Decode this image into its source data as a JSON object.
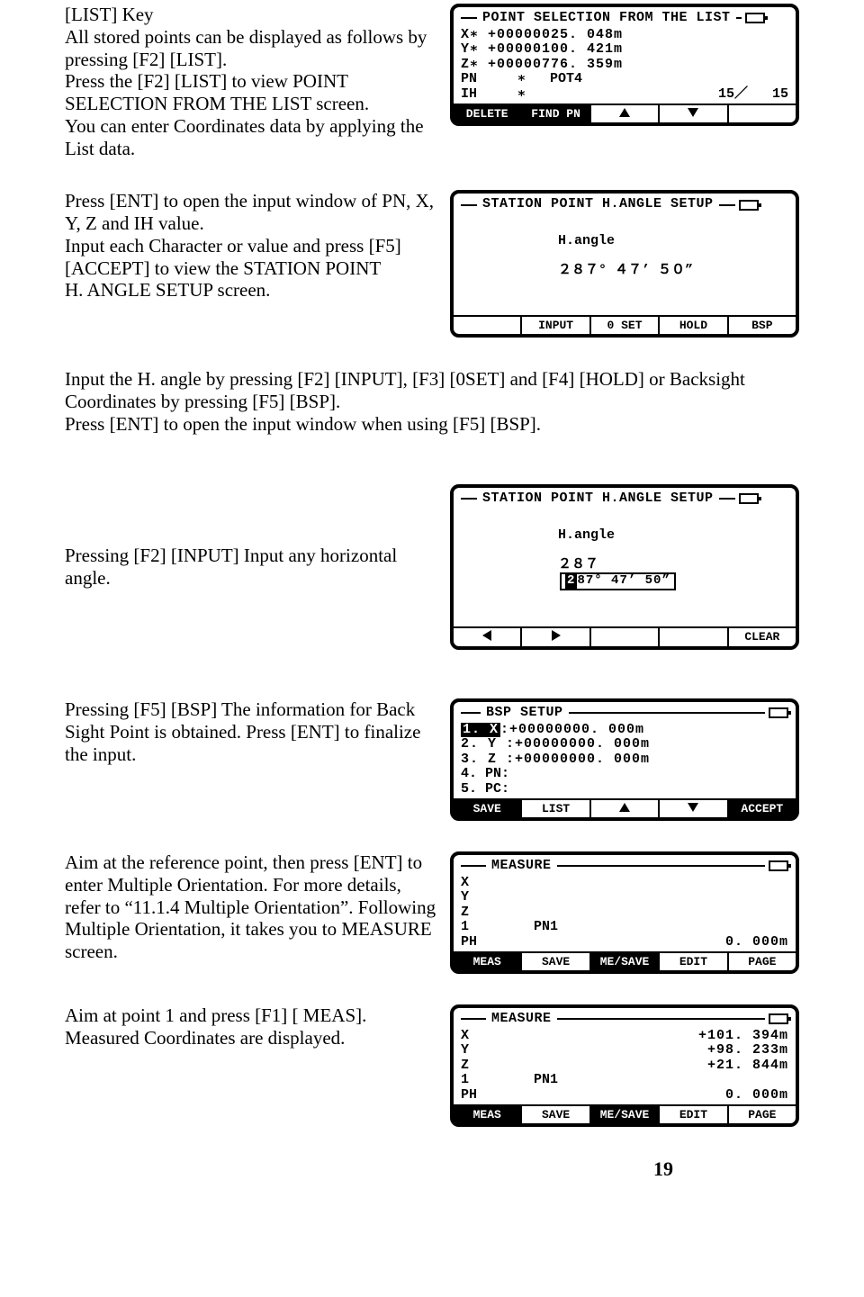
{
  "p1": {
    "l1": "[LIST] Key",
    "l2": "All stored points can be displayed as follows by pressing [F2] [LIST].",
    "l3": "Press the [F2] [LIST] to view POINT SELECTION FROM THE LIST screen.",
    "l4": "You can enter Coordinates data by applying the List data."
  },
  "p2": {
    "l1": "Press [ENT] to open the input window of PN, X, Y, Z and IH value.",
    "l2": "Input each Character or value and press [F5] [ACCEPT] to view the STATION POINT",
    "l3": "H. ANGLE SETUP screen."
  },
  "p3": {
    "l1": "Input the H. angle by pressing [F2] [INPUT], [F3] [0SET] and [F4] [HOLD] or Backsight Coordinates by pressing [F5] [BSP].",
    "l2": "Press [ENT] to open the input window when using [F5] [BSP]."
  },
  "p4": "Pressing [F2] [INPUT] Input any horizontal angle.",
  "p5": "Pressing [F5] [BSP] The information for Back Sight Point is obtained. Press [ENT] to finalize the input.",
  "p6": "Aim at the reference point, then press [ENT] to enter  Multiple Orientation. For more details, refer to “11.1.4  Multiple Orientation”. Following Multiple Orientation, it takes you to MEASURE screen.",
  "p7": "Aim at point 1 and press [F1] [ MEAS]. Measured Coordinates are displayed.",
  "page_number": "19",
  "s1": {
    "title": "POINT SELECTION FROM THE LIST",
    "x": "X∗ +00000025. 048m",
    "y": "Y∗ +00000100. 421m",
    "z": "Z∗ +00000776. 359m",
    "pn": "PN     ∗   POT4",
    "ih_l": "IH     ∗",
    "ih_r": "15／   15",
    "sk1": "DELETE",
    "sk2": "FIND PN"
  },
  "s2": {
    "title": "STATION POINT H.ANGLE SETUP",
    "lab": "H.angle",
    "val": "２８７° ４７’ ５０”",
    "sk2": "INPUT",
    "sk3": "0 SET",
    "sk4": "HOLD",
    "sk5": "BSP"
  },
  "s3": {
    "title": "STATION POINT H.ANGLE SETUP",
    "lab": "H.angle",
    "pre": "２８７",
    "cur": "2",
    "rest": "87° 47’ 50”",
    "sk5": "CLEAR"
  },
  "s4": {
    "title": "BSP SETUP",
    "r1a": "1. X",
    "r1b": ":+00000000. 000m",
    "r2": "2. Y :+00000000. 000m",
    "r3": "3. Z :+00000000. 000m",
    "r4": "4. PN:",
    "r5": "5. PC:",
    "sk1": "SAVE",
    "sk2": "LIST",
    "sk5": "ACCEPT"
  },
  "s5": {
    "title": "MEASURE",
    "x": "X",
    "y": "Y",
    "z": "Z",
    "n": "1        PN1",
    "ph_l": "PH",
    "ph_r": "0. 000m",
    "sk1": "MEAS",
    "sk2": "SAVE",
    "sk3": "ME/SAVE",
    "sk4": "EDIT",
    "sk5": "PAGE"
  },
  "s6": {
    "title": "MEASURE",
    "xl": "X",
    "xr": "+101. 394m",
    "yl": "Y",
    "yr": "+98. 233m",
    "zl": "Z",
    "zr": "+21. 844m",
    "n": "1        PN1",
    "ph_l": "PH",
    "ph_r": "0. 000m",
    "sk1": "MEAS",
    "sk2": "SAVE",
    "sk3": "ME/SAVE",
    "sk4": "EDIT",
    "sk5": "PAGE"
  }
}
